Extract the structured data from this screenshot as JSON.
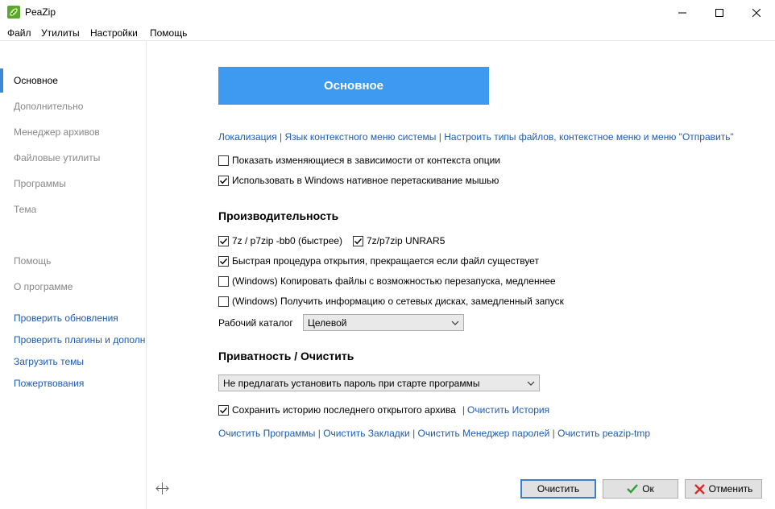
{
  "window": {
    "title": "PeaZip"
  },
  "menu": {
    "items": [
      "Файл",
      "Утилиты",
      "Настройки",
      "Помощь"
    ]
  },
  "sidebar": {
    "items": [
      "Основное",
      "Дополнительно",
      "Менеджер архивов",
      "Файловые утилиты",
      "Программы",
      "Тема"
    ],
    "help": [
      "Помощь",
      "О программе"
    ],
    "links": [
      "Проверить обновления",
      "Проверить плагины и дополн",
      "Загрузить темы",
      "Пожертвования"
    ]
  },
  "main": {
    "banner": "Основное",
    "top_links": [
      "Локализация",
      "Язык контекстного меню системы",
      "Настроить типы файлов, контекстное меню и меню \"Отправить\""
    ],
    "separator": "|",
    "options": [
      {
        "label": "Показать изменяющиеся в зависимости от контекста опции",
        "checked": false
      },
      {
        "label": "Использовать в Windows нативное перетаскивание мышью",
        "checked": true
      }
    ],
    "performance": {
      "title": "Производительность",
      "opt_7z": {
        "label": "7z / p7zip -bb0 (быстрее)",
        "checked": true
      },
      "opt_unrar": {
        "label": "7z/p7zip UNRAR5",
        "checked": true
      },
      "options": [
        {
          "label": "Быстрая процедура открытия, прекращается если файл существует",
          "checked": true
        },
        {
          "label": "(Windows) Копировать файлы с возможностью перезапуска, медленнее",
          "checked": false
        },
        {
          "label": "(Windows) Получить информацию о сетевых дисках, замедленный запуск",
          "checked": false
        }
      ],
      "workdir_label": "Рабочий каталог",
      "workdir_value": "Целевой"
    },
    "privacy": {
      "title": "Приватность / Очистить",
      "password_select": "Не предлагать установить пароль при старте программы",
      "history_opt": {
        "label": "Сохранить историю последнего открытого архива",
        "checked": true
      },
      "history_link": "Очистить История",
      "clear_links": [
        "Очистить Программы",
        "Очистить Закладки",
        "Очистить Менеджер паролей",
        "Очистить peazip-tmp"
      ]
    }
  },
  "buttons": {
    "clear": "Очистить",
    "ok": "Ок",
    "cancel": "Отменить"
  },
  "colors": {
    "accent": "#3d9af0",
    "link": "#1f5bb0",
    "ok_icon": "#2e9e3a",
    "cancel_icon": "#d12b2b",
    "peazip_icon": "#5aa832"
  }
}
